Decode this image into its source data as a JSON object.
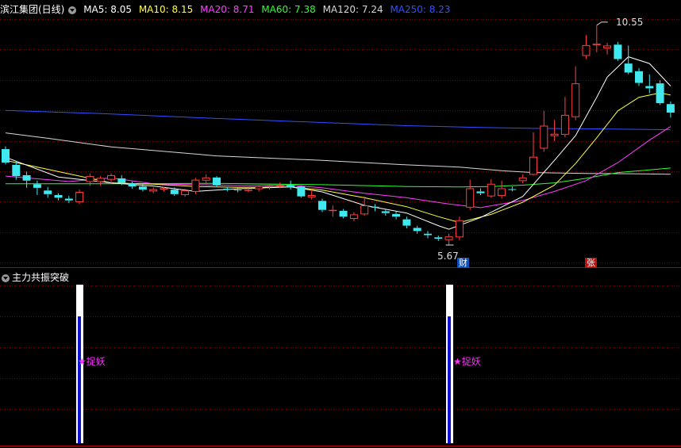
{
  "header": {
    "title": "滨江集团(日线)",
    "indicators": [
      {
        "label": "MA5: 8.05",
        "color": "#ffffff"
      },
      {
        "label": "MA10: 8.15",
        "color": "#ffff40"
      },
      {
        "label": "MA20: 8.71",
        "color": "#ff40ff"
      },
      {
        "label": "MA60: 7.38",
        "color": "#30ff30"
      },
      {
        "label": "MA120: 7.24",
        "color": "#d8d8d8"
      },
      {
        "label": "MA250: 8.23",
        "color": "#3050ff"
      }
    ]
  },
  "subpanel": {
    "title": "主力共振突破",
    "signal_label": "★捉妖"
  },
  "annotations": {
    "high_label": "10.55",
    "low_label": "5.67",
    "badge_cai": "财",
    "badge_zhang": "张"
  },
  "colors": {
    "up": "#ff4040",
    "down": "#40e8f0",
    "ma5": "#ffffff",
    "ma10": "#ffff40",
    "ma20": "#ff40ff",
    "ma60": "#30ff30",
    "ma120": "#d8d8d8",
    "ma250": "#3050ff",
    "grid": "#7a0000",
    "signal_white": "#ffffff",
    "signal_blue": "#1010d0",
    "signal_text": "#ff30ff"
  },
  "chart_data": {
    "type": "candlestick",
    "price_range": [
      5.3,
      10.9
    ],
    "candles": [
      [
        7.8,
        7.5,
        7.86,
        7.46
      ],
      [
        7.45,
        7.2,
        7.52,
        7.12
      ],
      [
        7.22,
        7.1,
        7.3,
        6.94
      ],
      [
        7.02,
        6.94,
        7.1,
        6.78
      ],
      [
        6.88,
        6.8,
        6.96,
        6.72
      ],
      [
        6.78,
        6.72,
        6.82,
        6.66
      ],
      [
        6.7,
        6.66,
        6.76,
        6.6
      ],
      [
        6.62,
        6.85,
        6.9,
        6.58
      ],
      [
        7.07,
        7.2,
        7.26,
        6.98
      ],
      [
        7.07,
        7.16,
        7.2,
        6.98
      ],
      [
        7.12,
        7.22,
        7.26,
        7.04
      ],
      [
        7.15,
        7.05,
        7.22,
        7.0
      ],
      [
        7.04,
        6.97,
        7.08,
        6.92
      ],
      [
        6.97,
        6.9,
        7.03,
        6.86
      ],
      [
        6.86,
        6.91,
        6.95,
        6.82
      ],
      [
        6.91,
        6.93,
        6.96,
        6.86
      ],
      [
        6.9,
        6.8,
        6.95,
        6.76
      ],
      [
        6.78,
        6.88,
        6.92,
        6.74
      ],
      [
        6.85,
        7.12,
        7.16,
        6.8
      ],
      [
        7.1,
        7.17,
        7.24,
        7.02
      ],
      [
        7.17,
        7.0,
        7.2,
        6.96
      ],
      [
        6.92,
        6.9,
        6.96,
        6.86
      ],
      [
        6.9,
        6.89,
        6.94,
        6.84
      ],
      [
        6.88,
        6.9,
        6.94,
        6.84
      ],
      [
        6.91,
        6.97,
        7.0,
        6.86
      ],
      [
        6.97,
        6.98,
        7.04,
        6.9
      ],
      [
        6.99,
        7.0,
        7.06,
        6.94
      ],
      [
        7.0,
        6.95,
        7.1,
        6.9
      ],
      [
        6.97,
        6.75,
        6.99,
        6.72
      ],
      [
        6.73,
        6.78,
        6.9,
        6.68
      ],
      [
        6.65,
        6.45,
        6.7,
        6.4
      ],
      [
        6.45,
        6.45,
        6.55,
        6.3
      ],
      [
        6.43,
        6.3,
        6.47,
        6.26
      ],
      [
        6.25,
        6.35,
        6.4,
        6.2
      ],
      [
        6.35,
        6.55,
        6.75,
        6.32
      ],
      [
        6.52,
        6.5,
        6.58,
        6.42
      ],
      [
        6.42,
        6.38,
        6.48,
        6.32
      ],
      [
        6.36,
        6.3,
        6.42,
        6.24
      ],
      [
        6.24,
        6.1,
        6.3,
        6.04
      ],
      [
        6.05,
        5.98,
        6.1,
        5.92
      ],
      [
        5.92,
        5.89,
        5.98,
        5.82
      ],
      [
        5.84,
        5.81,
        5.88,
        5.76
      ],
      [
        5.78,
        5.86,
        5.92,
        5.67
      ],
      [
        5.84,
        6.22,
        6.3,
        5.78
      ],
      [
        6.5,
        6.93,
        7.12,
        6.45
      ],
      [
        6.86,
        6.82,
        6.93,
        6.78
      ],
      [
        6.75,
        7.03,
        7.13,
        6.72
      ],
      [
        6.76,
        6.93,
        7.1,
        6.7
      ],
      [
        6.91,
        6.9,
        6.97,
        6.86
      ],
      [
        7.09,
        7.17,
        7.24,
        7.04
      ],
      [
        7.23,
        7.63,
        8.17,
        7.21
      ],
      [
        7.81,
        8.32,
        8.65,
        7.74
      ],
      [
        8.09,
        8.14,
        8.45,
        7.98
      ],
      [
        8.12,
        8.56,
        8.96,
        8.06
      ],
      [
        8.51,
        9.26,
        9.64,
        8.44
      ],
      [
        9.87,
        10.11,
        10.33,
        9.8
      ],
      [
        10.11,
        10.14,
        10.55,
        9.95
      ],
      [
        10.04,
        10.1,
        10.16,
        9.9
      ],
      [
        10.12,
        9.8,
        10.18,
        9.76
      ],
      [
        9.7,
        9.5,
        10.1,
        9.46
      ],
      [
        9.53,
        9.27,
        9.6,
        9.2
      ],
      [
        9.2,
        9.15,
        9.46,
        9.04
      ],
      [
        9.26,
        8.82,
        9.33,
        8.78
      ],
      [
        8.8,
        8.61,
        8.86,
        8.5
      ]
    ],
    "high_marker": {
      "value": 10.55,
      "candle_index": 56
    },
    "low_marker": {
      "value": 5.67,
      "candle_index": 42
    },
    "signal_candle_indices": [
      7,
      42
    ],
    "ma5": [
      [
        0,
        7.62
      ],
      [
        5,
        7.18
      ],
      [
        10,
        7.05
      ],
      [
        14,
        6.98
      ],
      [
        18,
        6.86
      ],
      [
        22,
        6.92
      ],
      [
        27,
        6.96
      ],
      [
        30,
        6.85
      ],
      [
        34,
        6.55
      ],
      [
        38,
        6.38
      ],
      [
        41,
        6.1
      ],
      [
        42,
        6.02
      ],
      [
        45,
        6.28
      ],
      [
        49,
        6.75
      ],
      [
        52,
        7.55
      ],
      [
        54,
        8.1
      ],
      [
        56,
        8.95
      ],
      [
        57,
        9.4
      ],
      [
        59,
        9.85
      ],
      [
        61,
        9.7
      ],
      [
        63,
        9.2
      ]
    ],
    "ma10": [
      [
        0,
        7.55
      ],
      [
        5,
        7.3
      ],
      [
        10,
        7.05
      ],
      [
        14,
        7.02
      ],
      [
        18,
        6.97
      ],
      [
        22,
        6.95
      ],
      [
        27,
        6.96
      ],
      [
        30,
        6.89
      ],
      [
        34,
        6.72
      ],
      [
        38,
        6.52
      ],
      [
        41,
        6.3
      ],
      [
        43,
        6.17
      ],
      [
        46,
        6.35
      ],
      [
        49,
        6.62
      ],
      [
        52,
        7.0
      ],
      [
        54,
        7.48
      ],
      [
        56,
        8.05
      ],
      [
        58,
        8.65
      ],
      [
        60,
        8.95
      ],
      [
        62,
        9.05
      ],
      [
        63,
        9.0
      ]
    ],
    "ma20": [
      [
        0,
        7.2
      ],
      [
        6,
        7.08
      ],
      [
        10,
        7.16
      ],
      [
        14,
        7.03
      ],
      [
        18,
        7.01
      ],
      [
        22,
        6.99
      ],
      [
        27,
        7.0
      ],
      [
        30,
        6.94
      ],
      [
        34,
        6.82
      ],
      [
        38,
        6.72
      ],
      [
        42,
        6.58
      ],
      [
        45,
        6.5
      ],
      [
        47,
        6.58
      ],
      [
        49,
        6.66
      ],
      [
        52,
        6.86
      ],
      [
        55,
        7.1
      ],
      [
        58,
        7.5
      ],
      [
        61,
        8.0
      ],
      [
        63,
        8.3
      ]
    ],
    "ma60": [
      [
        0,
        7.03
      ],
      [
        10,
        7.03
      ],
      [
        20,
        7.04
      ],
      [
        30,
        7.01
      ],
      [
        38,
        6.97
      ],
      [
        43,
        6.96
      ],
      [
        46,
        6.97
      ],
      [
        49,
        7.0
      ],
      [
        52,
        7.05
      ],
      [
        55,
        7.15
      ],
      [
        58,
        7.28
      ],
      [
        61,
        7.34
      ],
      [
        63,
        7.38
      ]
    ],
    "ma120": [
      [
        0,
        8.16
      ],
      [
        4,
        8.04
      ],
      [
        10,
        7.85
      ],
      [
        20,
        7.65
      ],
      [
        30,
        7.55
      ],
      [
        38,
        7.45
      ],
      [
        43,
        7.4
      ],
      [
        47,
        7.32
      ],
      [
        50,
        7.28
      ],
      [
        55,
        7.26
      ],
      [
        60,
        7.25
      ],
      [
        63,
        7.24
      ]
    ],
    "ma250": [
      [
        0,
        8.66
      ],
      [
        10,
        8.58
      ],
      [
        20,
        8.48
      ],
      [
        30,
        8.39
      ],
      [
        38,
        8.32
      ],
      [
        45,
        8.28
      ],
      [
        50,
        8.26
      ],
      [
        56,
        8.25
      ],
      [
        63,
        8.23
      ]
    ]
  }
}
